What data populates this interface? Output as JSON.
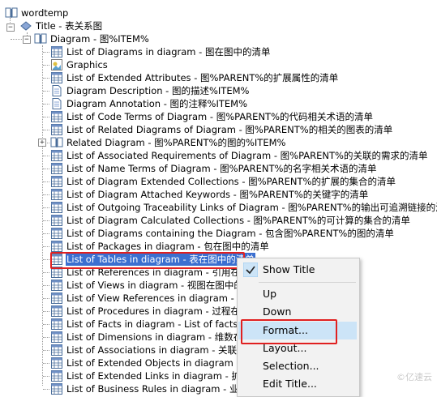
{
  "tree": {
    "root": "wordtemp",
    "title": "Title - 表关系图",
    "diagram": "Diagram - 图%ITEM%",
    "items": [
      {
        "label": "List of Diagrams in diagram - 图在图中的清单",
        "icon": "list-icon"
      },
      {
        "label": "Graphics",
        "icon": "graphics-icon"
      },
      {
        "label": "List of Extended Attributes - 图%PARENT%的扩展属性的清单",
        "icon": "list-icon"
      },
      {
        "label": "Diagram Description - 图的描述%ITEM%",
        "icon": "document-icon"
      },
      {
        "label": "Diagram Annotation - 图的注释%ITEM%",
        "icon": "document-icon"
      },
      {
        "label": "List of Code Terms of Diagram - 图%PARENT%的代码相关术语的清单",
        "icon": "list-icon"
      },
      {
        "label": "List of Related Diagrams of Diagram - 图%PARENT%的相关的图表的清单",
        "icon": "list-icon"
      },
      {
        "label": "Related Diagram - 图%PARENT%的图的%ITEM%",
        "icon": "book-icon",
        "expandable": true
      },
      {
        "label": "List of Associated Requirements of Diagram - 图%PARENT%的关联的需求的清单",
        "icon": "list-icon"
      },
      {
        "label": "List of Name Terms of Diagram - 图%PARENT%的名字相关术语的清单",
        "icon": "list-icon"
      },
      {
        "label": "List of Diagram Extended Collections - 图%PARENT%的扩展的集合的清单",
        "icon": "list-icon"
      },
      {
        "label": "List of Diagram Attached Keywords - 图%PARENT%的关键字的清单",
        "icon": "list-icon"
      },
      {
        "label": "List of Outgoing Traceability Links of Diagram - 图%PARENT%的输出可追溯链接的清单",
        "icon": "list-icon"
      },
      {
        "label": "List of Diagram Calculated Collections - 图%PARENT%的可计算的集合的清单",
        "icon": "list-icon"
      },
      {
        "label": "List of Diagrams containing the Diagram - 包含图%PARENT%的图的清单",
        "icon": "list-icon"
      },
      {
        "label": "List of Packages in diagram - 包在图中的清单",
        "icon": "list-icon"
      },
      {
        "label": "List of Tables in diagram - 表在图中的清单",
        "icon": "list-icon",
        "selected": true
      },
      {
        "label": "List of References in diagram - 引用在图中",
        "icon": "list-icon"
      },
      {
        "label": "List of Views in diagram - 视图在图中的清单",
        "icon": "list-icon"
      },
      {
        "label": "List of View References in diagram - 视图引",
        "icon": "list-icon"
      },
      {
        "label": "List of Procedures in diagram - 过程在图中的",
        "icon": "list-icon"
      },
      {
        "label": "List of Facts in diagram - List of facts in diagr",
        "icon": "list-icon"
      },
      {
        "label": "List of Dimensions in diagram - 维数在图中的",
        "icon": "list-icon"
      },
      {
        "label": "List of Associations in diagram - 关联在图中",
        "icon": "list-icon"
      },
      {
        "label": "List of Extended Objects in diagram - 扩展对",
        "icon": "list-icon"
      },
      {
        "label": "List of Extended Links in diagram - 扩展的链",
        "icon": "list-icon"
      },
      {
        "label": "List of Business Rules in diagram - 业务规则",
        "icon": "list-icon"
      }
    ]
  },
  "context_menu": {
    "items": [
      {
        "label": "Show Title",
        "checked": true
      },
      {
        "separator": true
      },
      {
        "label": "Up"
      },
      {
        "label": "Down"
      },
      {
        "separator": true
      },
      {
        "label": "Format...",
        "highlighted": true
      },
      {
        "label": "Layout..."
      },
      {
        "label": "Selection..."
      },
      {
        "label": "Edit Title..."
      }
    ]
  },
  "watermark": "©亿速云",
  "colors": {
    "selection": "#3b6fd0",
    "annotation": "#e02020",
    "menu_hover": "#cce4f7"
  }
}
